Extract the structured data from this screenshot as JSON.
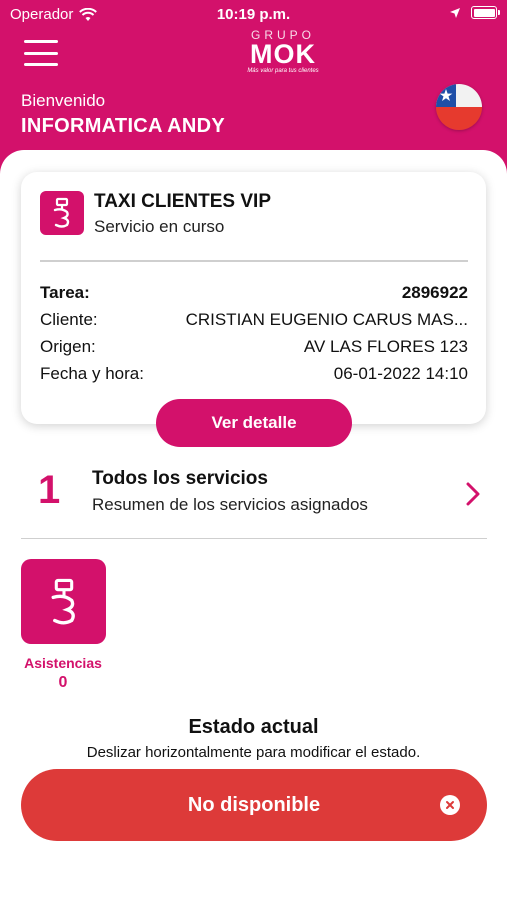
{
  "status_bar": {
    "carrier": "Operador",
    "time": "10:19 p.m."
  },
  "header": {
    "logo_top": "GRUPO",
    "logo_main": "MOK",
    "logo_tagline": "Más valor para tus clientes",
    "welcome": "Bienvenido",
    "username": "INFORMATICA ANDY",
    "flag_icon": "chile-flag-icon"
  },
  "current_service": {
    "title": "TAXI CLIENTES VIP",
    "subtitle": "Servicio en curso",
    "rows": [
      {
        "label": "Tarea:",
        "value": "2896922"
      },
      {
        "label": "Cliente:",
        "value": "CRISTIAN EUGENIO CARUS MAS..."
      },
      {
        "label": "Origen:",
        "value": "AV LAS FLORES 123"
      },
      {
        "label": "Fecha y hora:",
        "value": "06-01-2022 14:10"
      }
    ],
    "detail_button": "Ver detalle"
  },
  "services_summary": {
    "count": "1",
    "title": "Todos los servicios",
    "subtitle": "Resumen de los servicios asignados"
  },
  "assistances": {
    "label": "Asistencias",
    "count": "0"
  },
  "status": {
    "title": "Estado actual",
    "hint": "Deslizar horizontalmente para modificar el estado.",
    "current": "No disponible",
    "color": "#dd3a39"
  },
  "colors": {
    "brand": "#d3116b",
    "unavailable": "#dd3a39"
  }
}
